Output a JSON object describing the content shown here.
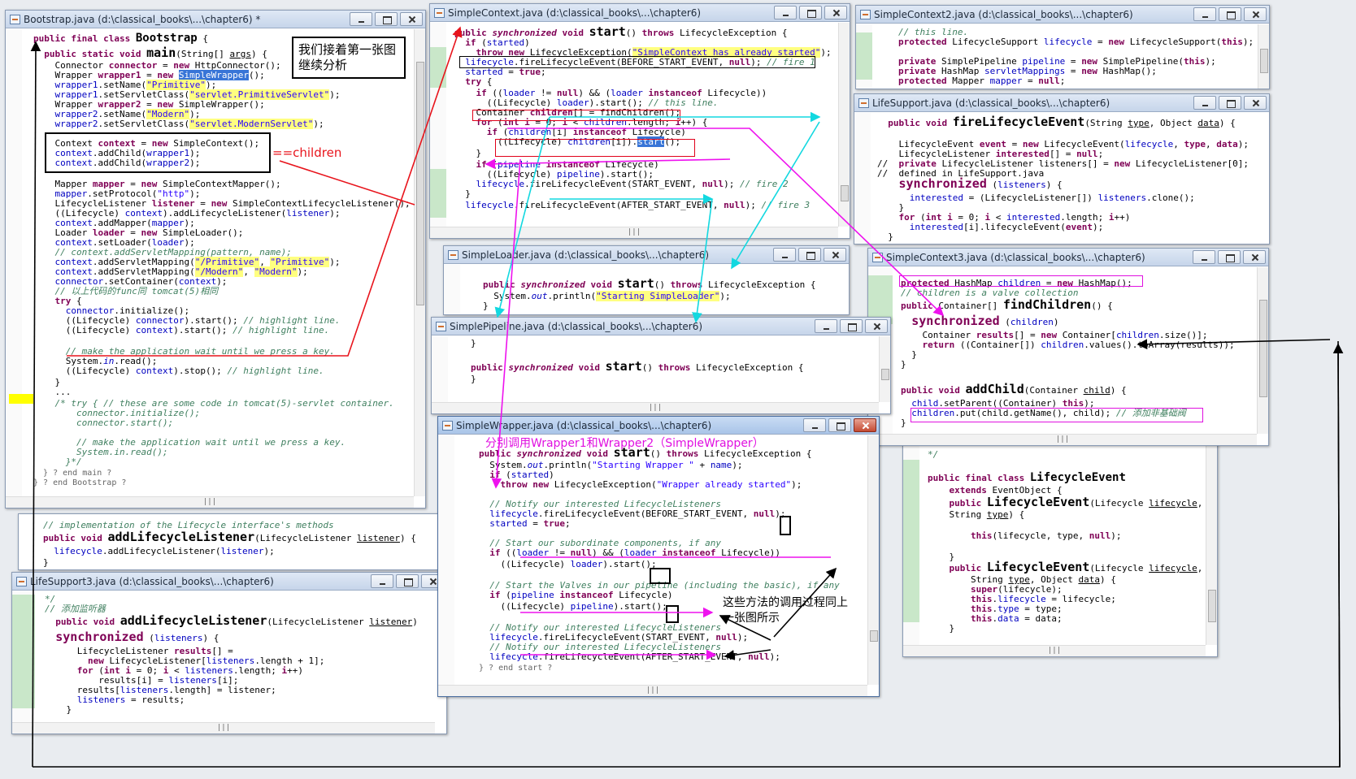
{
  "windows": [
    {
      "id": "bootstrap",
      "title": "Bootstrap.java  (d:\\classical_books\\...\\chapter6) *",
      "lines": [
        "public final class Bootstrap {",
        "  public static void main(String[] args) {",
        "    Connector connector = new HttpConnector();",
        "    Wrapper wrapper1 = new SimpleWrapper();",
        "    wrapper1.setName(\"Primitive\");",
        "    wrapper1.setServletClass(\"servlet.PrimitiveServlet\");",
        "    Wrapper wrapper2 = new SimpleWrapper();",
        "    wrapper2.setName(\"Modern\");",
        "    wrapper2.setServletClass(\"servlet.ModernServlet\");",
        "",
        "    Context context = new SimpleContext();",
        "    context.addChild(wrapper1);",
        "    context.addChild(wrapper2);",
        "",
        "    Mapper mapper = new SimpleContextMapper();",
        "    mapper.setProtocol(\"http\");",
        "    LifecycleListener listener = new SimpleContextLifecycleListener();",
        "    ((Lifecycle) context).addLifecycleListener(listener);",
        "    context.addMapper(mapper);",
        "    Loader loader = new SimpleLoader();",
        "    context.setLoader(loader);",
        "    // context.addServletMapping(pattern, name);",
        "    context.addServletMapping(\"/Primitive\", \"Primitive\");",
        "    context.addServletMapping(\"/Modern\", \"Modern\");",
        "    connector.setContainer(context);",
        "    // 以上代码的func同 tomcat(5)相同",
        "    try {",
        "      connector.initialize();",
        "      ((Lifecycle) connector).start(); // highlight line.",
        "      ((Lifecycle) context).start(); // highlight line.",
        "",
        "      // make the application wait until we press a key.",
        "      System.in.read();",
        "      ((Lifecycle) context).stop(); // highlight line.",
        "    }",
        "    ...",
        "    /* try { // these are some code in tomcat(5)-servlet container.",
        "        connector.initialize();",
        "        connector.start();",
        "",
        "        // make the application wait until we press a key.",
        "        System.in.read();",
        "      }*/",
        "  } ? end main ?",
        "} ? end Bootstrap ?"
      ]
    },
    {
      "id": "simplecontext",
      "title": "SimpleContext.java  (d:\\classical_books\\...\\chapter6)",
      "lines": [
        "public synchronized void start() throws LifecycleException {",
        "  if (started)",
        "    throw new LifecycleException(\"SimpleContext has already started\");",
        "  lifecycle.fireLifecycleEvent(BEFORE_START_EVENT, null); // fire 1",
        "  started = true;",
        "  try {",
        "    if ((loader != null) && (loader instanceof Lifecycle))",
        "      ((Lifecycle) loader).start(); // this line.",
        "    Container children[] = findChildren();",
        "    for (int i = 0; i < children.length; i++) {",
        "      if (children[i] instanceof Lifecycle)",
        "        ((Lifecycle) children[i]).start();",
        "    }",
        "    if (pipeline instanceof Lifecycle)",
        "      ((Lifecycle) pipeline).start();",
        "    lifecycle.fireLifecycleEvent(START_EVENT, null); // fire 2",
        "  }",
        "  lifecycle.fireLifecycleEvent(AFTER_START_EVENT, null); // fire 3"
      ]
    },
    {
      "id": "simplecontext2",
      "title": "SimpleContext2.java  (d:\\classical_books\\...\\chapter6)",
      "lines": [
        "// this line.",
        "protected LifecycleSupport lifecycle = new LifecycleSupport(this);",
        "",
        "private SimplePipeline pipeline = new SimplePipeline(this);",
        "private HashMap servletMappings = new HashMap();",
        "protected Mapper mapper = null;"
      ]
    },
    {
      "id": "lifesupport",
      "title": "LifeSupport.java  (d:\\classical_books\\...\\chapter6)",
      "lines": [
        "  public void fireLifecycleEvent(String type, Object data) {",
        "",
        "    LifecycleEvent event = new LifecycleEvent(lifecycle, type, data);",
        "    LifecycleListener interested[] = null;",
        "//  private LifecycleListener listeners[] = new LifecycleListener[0];",
        "//  defined in LifeSupport.java",
        "    synchronized (listeners) {",
        "      interested = (LifecycleListener[]) listeners.clone();",
        "    }",
        "    for (int i = 0; i < interested.length; i++)",
        "      interested[i].lifecycleEvent(event);",
        "  }"
      ]
    },
    {
      "id": "simpleloader",
      "title": "SimpleLoader.java  (d:\\classical_books\\...\\chapter6)",
      "lines": [
        "public synchronized void start() throws LifecycleException {",
        "  System.out.println(\"Starting SimpleLoader\");",
        "}"
      ]
    },
    {
      "id": "simplecontext3",
      "title": "SimpleContext3.java  (d:\\classical_books\\...\\chapter6)",
      "lines": [
        "protected HashMap children = new HashMap();",
        "// children is a valve collection",
        "public Container[] findChildren() {",
        "  synchronized (children) {",
        "    Container results[] = new Container[children.size()];",
        "    return ((Container[]) children.values().toArray(results));",
        "  }",
        "}",
        "",
        "public void addChild(Container child) {",
        "  child.setParent((Container) this);",
        "  children.put(child.getName(), child); // 添加非基础阀",
        "}"
      ]
    },
    {
      "id": "simplepipeline",
      "title": "SimplePipeline.java  (d:\\classical_books\\...\\chapter6)",
      "lines": [
        "}",
        "",
        "public synchronized void start() throws LifecycleException {",
        "}"
      ]
    },
    {
      "id": "simplewrapper",
      "title": "SimpleWrapper.java  (d:\\classical_books\\...\\chapter6)",
      "lines": [
        "public synchronized void start() throws LifecycleException {",
        "  System.out.println(\"Starting Wrapper \" + name);",
        "  if (started)",
        "    throw new LifecycleException(\"Wrapper already started\");",
        "",
        "  // Notify our interested LifecycleListeners",
        "  lifecycle.fireLifecycleEvent(BEFORE_START_EVENT, null);",
        "  started = true;",
        "",
        "  // Start our subordinate components, if any",
        "  if ((loader != null) && (loader instanceof Lifecycle))",
        "    ((Lifecycle) loader).start();",
        "",
        "  // Start the Valves in our pipeline (including the basic), if any",
        "  if (pipeline instanceof Lifecycle)",
        "    ((Lifecycle) pipeline).start();",
        "",
        "  // Notify our interested LifecycleListeners",
        "  lifecycle.fireLifecycleEvent(START_EVENT, null);",
        "  // Notify our interested LifecycleListeners",
        "  lifecycle.fireLifecycleEvent(AFTER_START_EVENT, null);",
        "} ? end start ?"
      ]
    },
    {
      "id": "lifecycleevent",
      "title": "",
      "lines": [
        "*/",
        "",
        "public final class LifecycleEvent",
        "    extends EventObject {",
        "    public LifecycleEvent(Lifecycle lifecycle,",
        "    String type) {",
        "",
        "        this(lifecycle, type, null);",
        "",
        "    }",
        "    public LifecycleEvent(Lifecycle lifecycle,",
        "        String type, Object data) {",
        "        super(lifecycle);",
        "        this.lifecycle = lifecycle;",
        "        this.type = type;",
        "        this.data = data;",
        "    }"
      ]
    },
    {
      "id": "addlistener",
      "title": "",
      "lines": [
        "// implementation of the Lifecycle interface's methods",
        "public void addLifecycleListener(LifecycleListener listener) {",
        "  lifecycle.addLifecycleListener(listener);",
        "}"
      ]
    },
    {
      "id": "lifesupport3",
      "title": "LifeSupport3.java  (d:\\classical_books\\...\\chapter6)",
      "lines": [
        "*/",
        "// 添加监听器",
        "public void addLifecycleListener(LifecycleListener listener)",
        "  synchronized (listeners) {",
        "    LifecycleListener results[] =",
        "      new LifecycleListener[listeners.length + 1];",
        "    for (int i = 0; i < listeners.length; i++)",
        "      results[i] = listeners[i];",
        "    results[listeners.length] = listener;",
        "    listeners = results;",
        "  }"
      ]
    }
  ],
  "annotations": {
    "intro_note": "我们接着第一张图继续分析",
    "children_note": "==children",
    "wrapper_note": "分别调用Wrapper1和Wrapper2（SimpleWrapper）",
    "same_process_note": "这些方法的调用过程同上一张图所示"
  },
  "colors": {
    "red_arrow": "#e8141c",
    "cyan_arrow": "#12d8e0",
    "magenta_arrow": "#ee12ee",
    "black_arrow": "#000000"
  }
}
